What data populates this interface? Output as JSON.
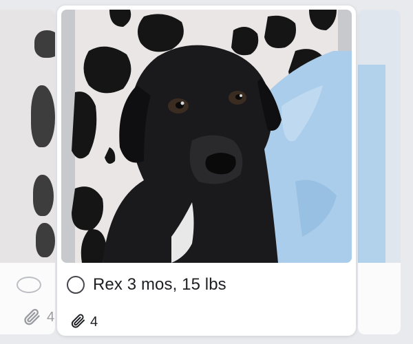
{
  "board": {
    "main_card": {
      "title": "Rex 3 mos, 15 lbs",
      "attachment_count": "4",
      "photo_description_icon": "dog-photo"
    },
    "left_card": {
      "attachment_count": "4"
    }
  },
  "icons": {
    "complete": "circle-outline-icon",
    "attachment": "paperclip-icon"
  },
  "colors": {
    "card_bg": "#ffffff",
    "board_bg": "#e9eaee",
    "text": "#1e1f23",
    "tarp_blue": "#a9cdea"
  }
}
